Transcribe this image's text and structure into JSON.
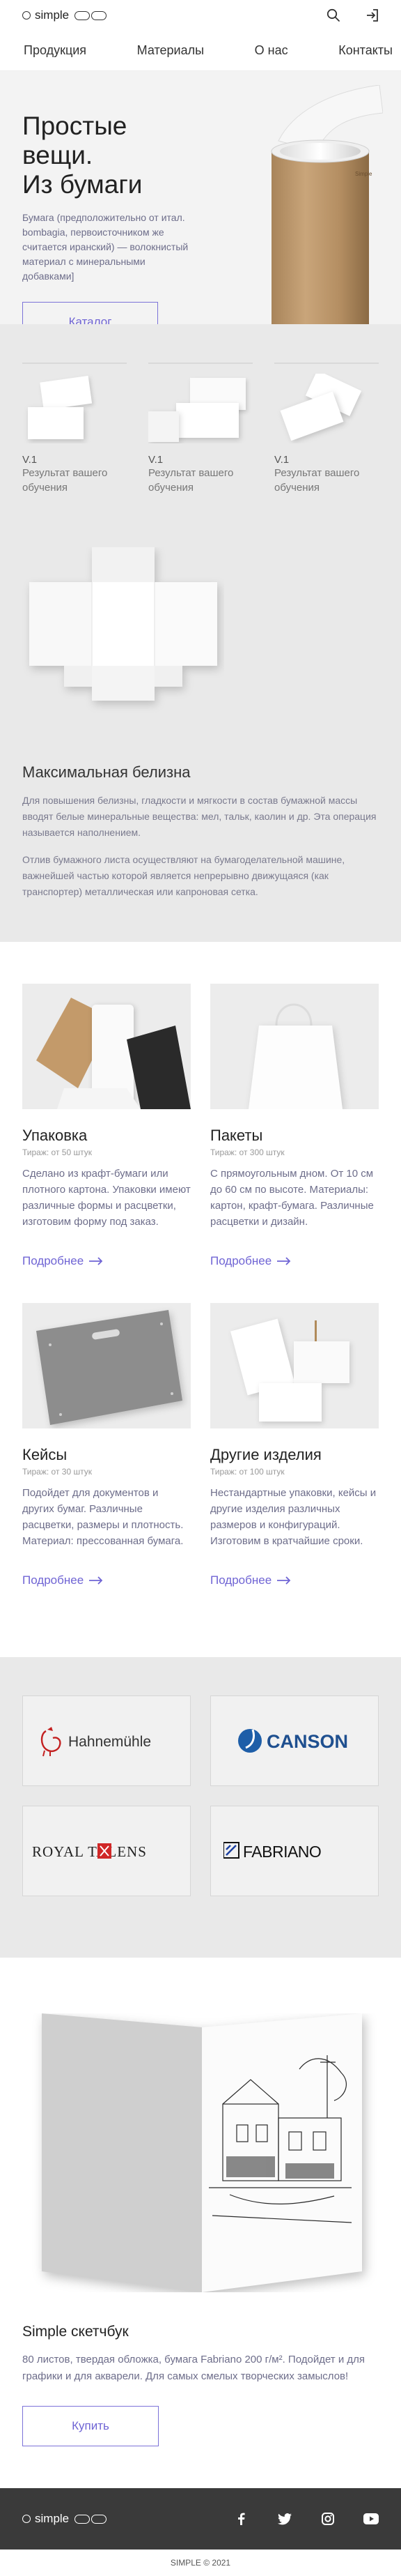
{
  "header": {
    "logo_text": "simple"
  },
  "nav": {
    "items": [
      "Продукция",
      "Материалы",
      "О нас",
      "Контакты"
    ]
  },
  "hero": {
    "title_line1": "Простые вещи.",
    "title_line2": "Из бумаги",
    "description": "Бумага (предположительно от итал. bombagia, первоисточником же считается иранский) — волокнистый материал с минеральными добавками]",
    "catalog_button": "Каталог"
  },
  "variants": [
    {
      "name": "V.1",
      "subtitle": "Результат вашего обучения"
    },
    {
      "name": "V.1",
      "subtitle": "Результат вашего обучения"
    },
    {
      "name": "V.1",
      "subtitle": "Результат вашего обучения"
    }
  ],
  "whiteness": {
    "title": "Максимальная белизна",
    "paragraph1": "Для повышения белизны, гладкости и мягкости в состав бумажной массы вводят белые минеральные вещества: мел, тальк, каолин и др. Эта операция называется наполнением.",
    "paragraph2": "Отлив бумажного листа осуществляют на бумагоделательной машине, важнейшей частью которой является непрерывно движущаяся (как транспортер) металлическая или капроновая сетка."
  },
  "products": [
    {
      "title": "Упаковка",
      "min_order": "Тираж: от 50 штук",
      "description": "Сделано из крафт-бумаги или плотного картона. Упаковки имеют различные формы и расцветки, изготовим форму под заказ.",
      "link": "Подробнее"
    },
    {
      "title": "Пакеты",
      "min_order": "Тираж: от 300 штук",
      "description": "С прямоугольным дном. От 10 см до 60 см по высоте. Материалы: картон, крафт-бумага. Различные расцветки и дизайн.",
      "link": "Подробнее"
    },
    {
      "title": "Кейсы",
      "min_order": "Тираж: от 30 штук",
      "description": "Подойдет для документов и других бумаг. Различные расцветки, размеры и плотность. Материал: прессованная бумага.",
      "link": "Подробнее"
    },
    {
      "title": "Другие изделия",
      "min_order": "Тираж: от 100 штук",
      "description": "Нестандартные упаковки, кейсы и другие изделия различных размеров и конфигураций. Изготовим в кратчайшие сроки.",
      "link": "Подробнее"
    }
  ],
  "brands": [
    "Hahnemühle",
    "CANSON",
    "ROYAL TALENS",
    "FABRIANO"
  ],
  "sketchbook": {
    "title": "Simple скетчбук",
    "description": "80 листов, твердая обложка, бумага  Fabriano 200 г/м². Подойдет и для графики и для акварели. Для самых смелых творческих замыслов!",
    "buy_button": "Купить",
    "tube_label": "Simple"
  },
  "footer": {
    "logo_text": "simple",
    "socials": [
      "facebook-icon",
      "twitter-icon",
      "instagram-icon",
      "youtube-icon"
    ],
    "copyright": "SIMPLE © 2021"
  },
  "colors": {
    "accent": "#6f64d4",
    "gray_bg": "#e9e9e9",
    "footer_bg": "#3a3a3a"
  }
}
